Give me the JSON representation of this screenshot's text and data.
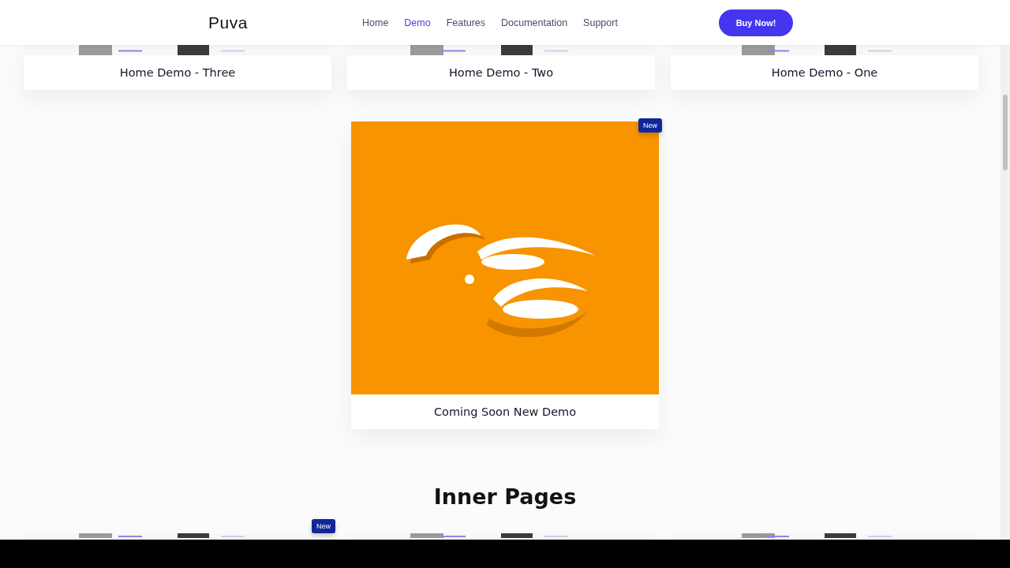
{
  "header": {
    "logo": "Puva",
    "nav": [
      {
        "label": "Home",
        "selected": false
      },
      {
        "label": "Demo",
        "selected": true
      },
      {
        "label": "Features",
        "selected": false
      },
      {
        "label": "Documentation",
        "selected": false
      },
      {
        "label": "Support",
        "selected": false
      }
    ],
    "button": "Buy Now!"
  },
  "top_demos": [
    {
      "title": "Home Demo - Three"
    },
    {
      "title": "Home Demo - Two"
    },
    {
      "title": "Home Demo - One"
    }
  ],
  "featured": {
    "title": "Coming Soon New Demo",
    "badge": "New",
    "kind": "picture"
  },
  "section": {
    "heading": "Inner Pages"
  },
  "inner_pages": {
    "badge": "New",
    "cards": [
      {
        "new": true
      },
      {
        "new": false
      },
      {
        "new": false
      }
    ]
  }
}
